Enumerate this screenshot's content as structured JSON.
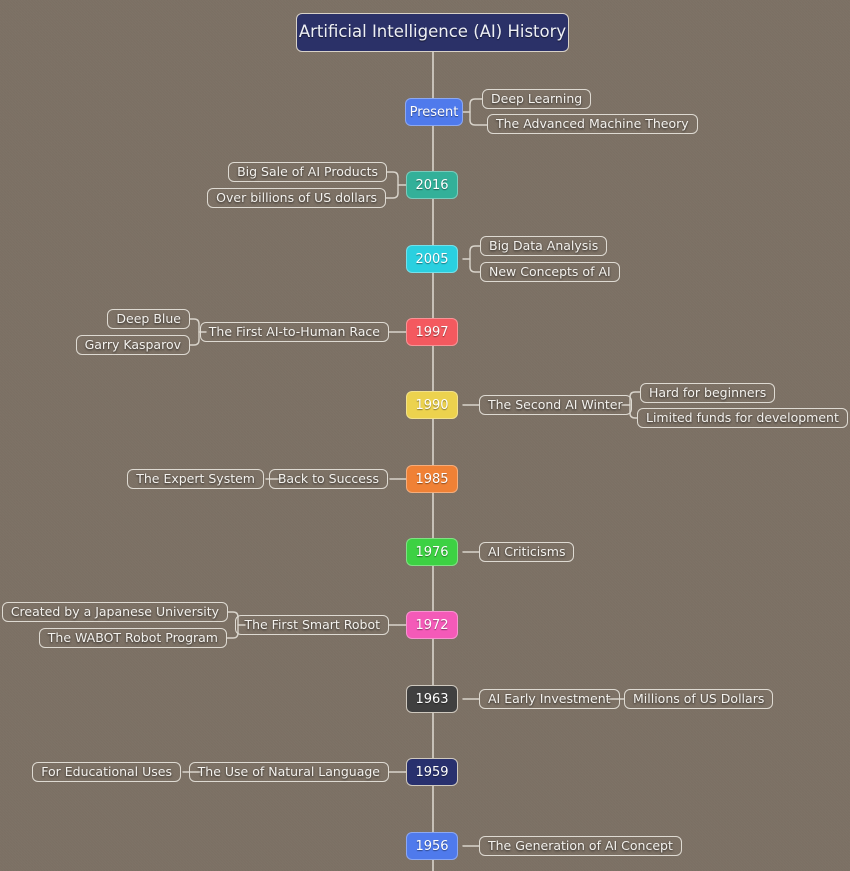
{
  "diagram": {
    "type": "mindmap-timeline",
    "title": "Artificial Intelligence (AI) History",
    "background_color": "#7d7164",
    "spine_color": "#d9d4cb",
    "root": {
      "label": "Artificial Intelligence (AI) History",
      "fill": "#2b3168",
      "text_color": "#eef0f6"
    },
    "nodes": [
      {
        "id": "present",
        "label": "Present",
        "fill": "#4f7aec",
        "side": "right",
        "children": [
          {
            "label": "Deep Learning"
          },
          {
            "label": "The Advanced Machine Theory"
          }
        ]
      },
      {
        "id": "y2016",
        "label": "2016",
        "fill": "#33b099",
        "side": "left",
        "children": [
          {
            "label": "Big Sale of AI Products"
          },
          {
            "label": "Over billions of US dollars"
          }
        ]
      },
      {
        "id": "y2005",
        "label": "2005",
        "fill": "#2ad0e0",
        "side": "right",
        "children": [
          {
            "label": "Big Data Analysis"
          },
          {
            "label": "New Concepts of AI"
          }
        ]
      },
      {
        "id": "y1997",
        "label": "1997",
        "fill": "#f4595f",
        "side": "left",
        "children": [
          {
            "label": "The First AI-to-Human Race",
            "children": [
              {
                "label": "Deep Blue"
              },
              {
                "label": "Garry Kasparov"
              }
            ]
          }
        ]
      },
      {
        "id": "y1990",
        "label": "1990",
        "fill": "#ecd24e",
        "side": "right",
        "children": [
          {
            "label": "The Second AI Winter",
            "children": [
              {
                "label": "Hard for beginners"
              },
              {
                "label": "Limited funds for development"
              }
            ]
          }
        ]
      },
      {
        "id": "y1985",
        "label": "1985",
        "fill": "#f08135",
        "side": "left",
        "children": [
          {
            "label": "Back to Success",
            "children": [
              {
                "label": "The Expert System"
              }
            ]
          }
        ]
      },
      {
        "id": "y1976",
        "label": "1976",
        "fill": "#3dd143",
        "side": "right",
        "children": [
          {
            "label": "AI Criticisms"
          }
        ]
      },
      {
        "id": "y1972",
        "label": "1972",
        "fill": "#f45ab8",
        "side": "left",
        "children": [
          {
            "label": "The First Smart Robot",
            "children": [
              {
                "label": "Created by a Japanese University"
              },
              {
                "label": "The WABOT Robot Program"
              }
            ]
          }
        ]
      },
      {
        "id": "y1963",
        "label": "1963",
        "fill": "#404040",
        "side": "right",
        "children": [
          {
            "label": "AI Early Investment",
            "children": [
              {
                "label": "Millions of US Dollars"
              }
            ]
          }
        ]
      },
      {
        "id": "y1959",
        "label": "1959",
        "fill": "#28306e",
        "side": "left",
        "children": [
          {
            "label": "The Use of Natural Language",
            "children": [
              {
                "label": "For Educational Uses"
              }
            ]
          }
        ]
      },
      {
        "id": "y1956",
        "label": "1956",
        "fill": "#4f7aec",
        "side": "right",
        "children": [
          {
            "label": "The Generation of AI Concept"
          }
        ]
      }
    ]
  }
}
